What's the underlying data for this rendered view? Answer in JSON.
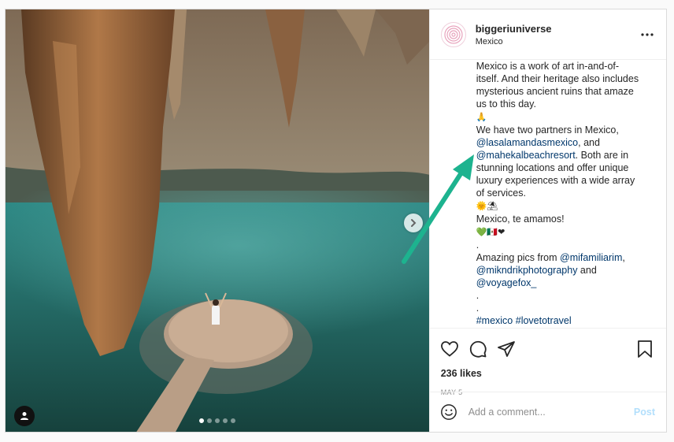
{
  "post": {
    "username": "biggeriuniverse",
    "location": "Mexico",
    "caption": [
      [
        {
          "t": "Mexico is a work of art in-and-of-"
        }
      ],
      [
        {
          "t": "itself. And their heritage also includes"
        }
      ],
      [
        {
          "t": "mysterious ancient ruins that amaze"
        }
      ],
      [
        {
          "t": "us to this day."
        }
      ],
      [
        {
          "t": "🙏",
          "emoji": true
        }
      ],
      [
        {
          "t": "We have two partners in Mexico,"
        }
      ],
      [
        {
          "t": "@lasalamandasmexico",
          "link": true
        },
        {
          "t": ", and"
        }
      ],
      [
        {
          "t": "@mahekalbeachresort",
          "link": true
        },
        {
          "t": ". Both are in"
        }
      ],
      [
        {
          "t": "stunning locations and offer unique"
        }
      ],
      [
        {
          "t": "luxury experiences with a wide array"
        }
      ],
      [
        {
          "t": "of services."
        }
      ],
      [
        {
          "t": "🌞⛱",
          "emoji": true
        }
      ],
      [
        {
          "t": "Mexico, te amamos!"
        }
      ],
      [
        {
          "t": "💚🇲🇽❤",
          "emoji": true
        }
      ],
      [
        {
          "t": "."
        }
      ],
      [
        {
          "t": "Amazing pics from "
        },
        {
          "t": "@mifamiliarim",
          "link": true
        },
        {
          "t": ","
        }
      ],
      [
        {
          "t": "@mikndrikphotography",
          "link": true
        },
        {
          "t": " and"
        }
      ],
      [
        {
          "t": "@voyagefox_",
          "link": true
        }
      ],
      [
        {
          "t": "."
        }
      ],
      [
        {
          "t": "."
        }
      ],
      [
        {
          "t": "#mexico",
          "link": true
        },
        {
          "t": " "
        },
        {
          "t": "#lovetotravel",
          "link": true
        }
      ]
    ],
    "likes": "236 likes",
    "date": "MAY 5",
    "comment_placeholder": "Add a comment...",
    "post_label": "Post",
    "carousel": {
      "count": 5,
      "active_index": 0
    }
  },
  "icons": {
    "more": "more-options-icon",
    "like": "heart-icon",
    "comment": "comment-bubble-icon",
    "share": "share-plane-icon",
    "save": "bookmark-icon",
    "emoji": "smiley-icon",
    "next": "chevron-right-icon",
    "tag": "user-tag-icon"
  },
  "colors": {
    "link": "#00376b",
    "annotation_arrow": "#1db38f",
    "post_disabled": "#b2dffc"
  }
}
